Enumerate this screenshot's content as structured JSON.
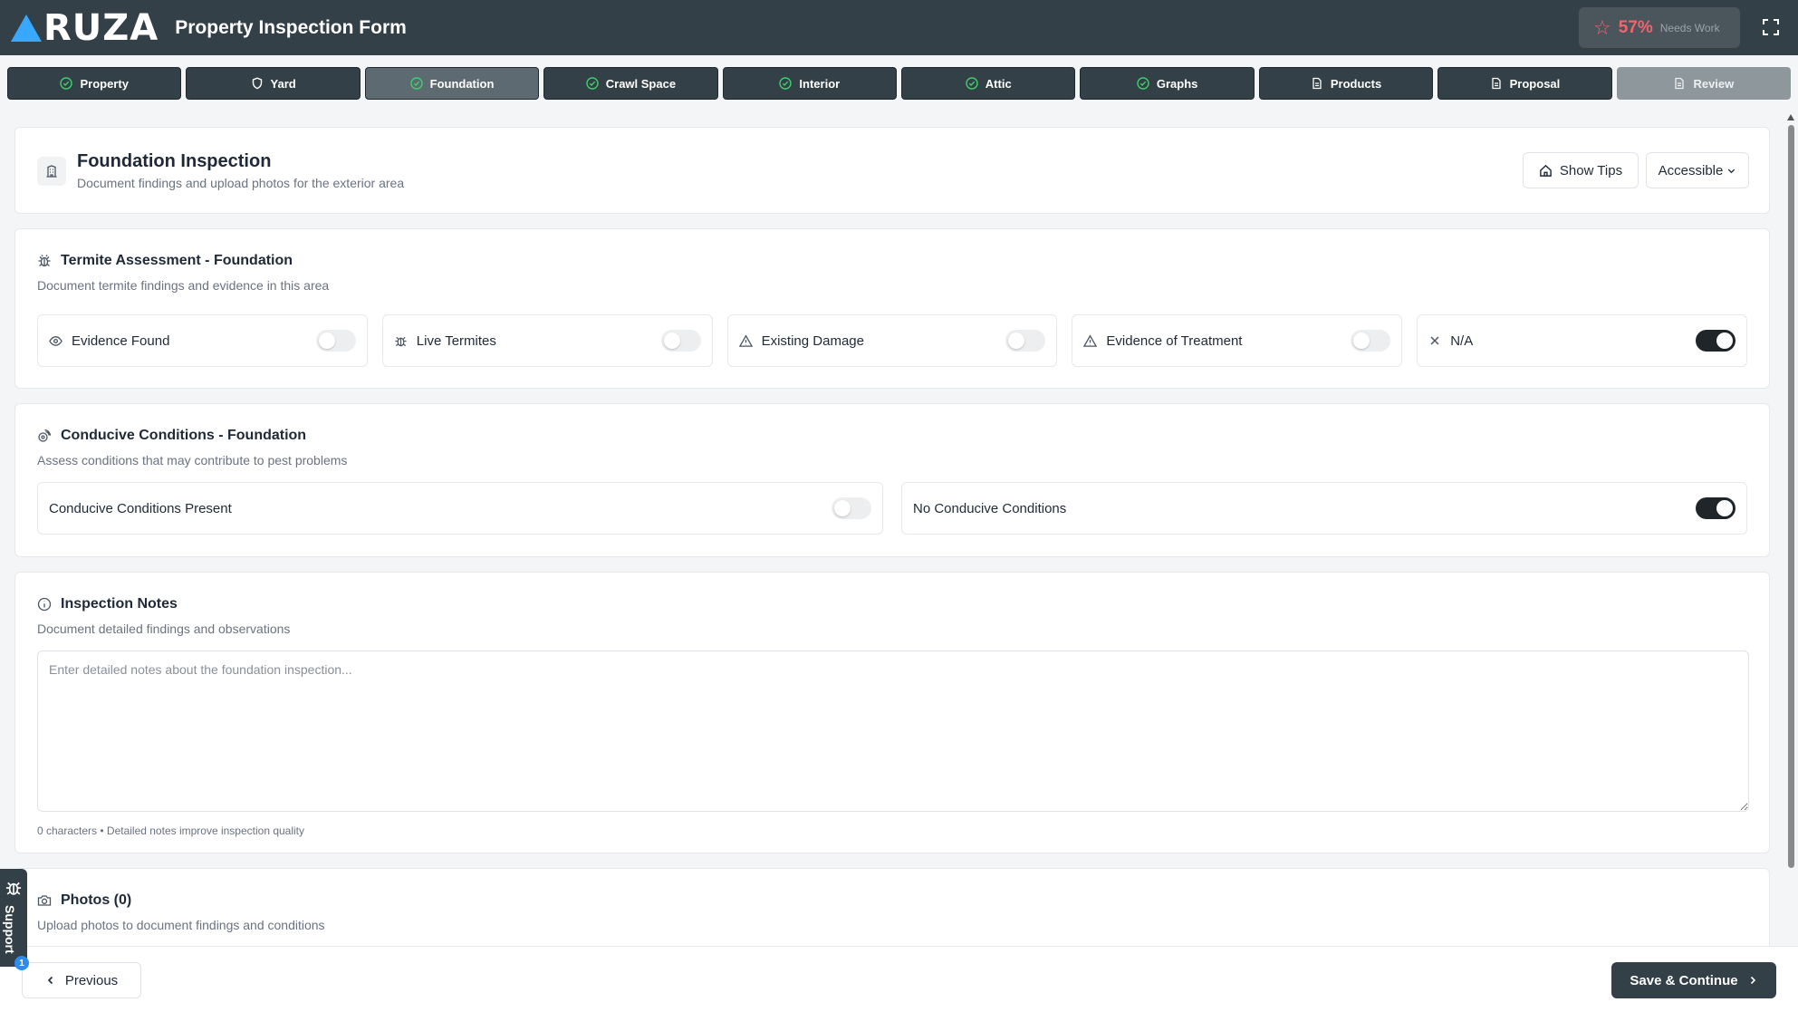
{
  "header": {
    "logo_text": "RUZA",
    "title": "Property Inspection Form",
    "score_percent": "57%",
    "score_status": "Needs Work"
  },
  "tabs": [
    {
      "label": "Property",
      "icon": "check-circle-icon",
      "state": "complete"
    },
    {
      "label": "Yard",
      "icon": "shield-icon",
      "state": "pending"
    },
    {
      "label": "Foundation",
      "icon": "check-circle-icon",
      "state": "active"
    },
    {
      "label": "Crawl Space",
      "icon": "check-circle-icon",
      "state": "complete"
    },
    {
      "label": "Interior",
      "icon": "check-circle-icon",
      "state": "complete"
    },
    {
      "label": "Attic",
      "icon": "check-circle-icon",
      "state": "complete"
    },
    {
      "label": "Graphs",
      "icon": "check-circle-icon",
      "state": "complete"
    },
    {
      "label": "Products",
      "icon": "document-icon",
      "state": "pending"
    },
    {
      "label": "Proposal",
      "icon": "document-icon",
      "state": "pending"
    },
    {
      "label": "Review",
      "icon": "document-icon",
      "state": "disabled"
    }
  ],
  "section_header": {
    "title": "Foundation Inspection",
    "subtitle": "Document findings and upload photos for the exterior area",
    "tips_label": "Show Tips",
    "accessibility_label": "Accessible"
  },
  "termite": {
    "title": "Termite Assessment - Foundation",
    "subtitle": "Document termite findings and evidence in this area",
    "toggles": [
      {
        "label": "Evidence Found",
        "icon": "eye-icon",
        "on": false
      },
      {
        "label": "Live Termites",
        "icon": "bug-icon",
        "on": false
      },
      {
        "label": "Existing Damage",
        "icon": "warning-icon",
        "on": false
      },
      {
        "label": "Evidence of Treatment",
        "icon": "warning-icon",
        "on": false
      },
      {
        "label": "N/A",
        "icon": "x-icon",
        "on": true
      }
    ]
  },
  "conducive": {
    "title": "Conducive Conditions - Foundation",
    "subtitle": "Assess conditions that may contribute to pest problems",
    "toggles": [
      {
        "label": "Conducive Conditions Present",
        "on": false
      },
      {
        "label": "No Conducive Conditions",
        "on": true
      }
    ]
  },
  "notes": {
    "title": "Inspection Notes",
    "subtitle": "Document detailed findings and observations",
    "placeholder": "Enter detailed notes about the foundation inspection...",
    "value": "",
    "char_count": "0 characters • Detailed notes improve inspection quality"
  },
  "photos": {
    "title": "Photos (0)",
    "subtitle": "Upload photos to document findings and conditions"
  },
  "footer": {
    "previous_label": "Previous",
    "save_label": "Save & Continue"
  },
  "support": {
    "label": "Support",
    "badge": "1"
  },
  "colors": {
    "header_bg": "#334047",
    "accent_blue": "#38a8ff",
    "score_red": "#f0646e",
    "check_green": "#3ecf6e"
  }
}
